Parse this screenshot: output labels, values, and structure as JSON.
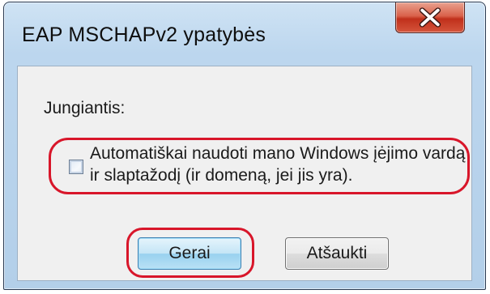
{
  "window": {
    "title": "EAP MSCHAPv2 ypatybės",
    "close_icon": "close-icon"
  },
  "dialog": {
    "connecting_label": "Jungiantis:",
    "checkbox": {
      "line1": "Automatiškai naudoti mano Windows įėjimo vardą",
      "line2": "ir slaptažodį (ir domeną, jei jis yra).",
      "checked": false
    },
    "buttons": {
      "ok_label": "Gerai",
      "cancel_label": "Atšaukti"
    }
  },
  "colors": {
    "highlight_ring": "#d8162a",
    "close_button": "#c0301b",
    "ok_button": "#98d1ef"
  }
}
